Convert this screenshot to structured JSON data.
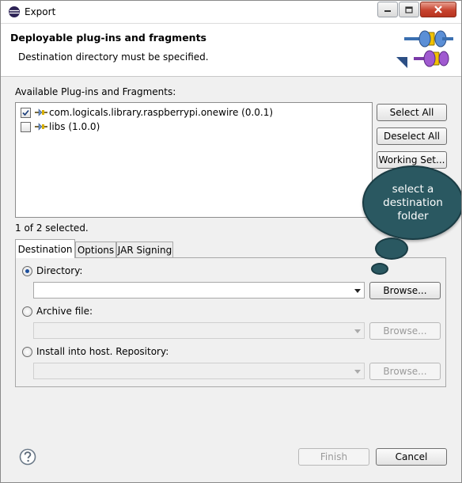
{
  "window": {
    "title": "Export",
    "minimize_label": "minimize",
    "maximize_label": "maximize",
    "close_label": "close"
  },
  "banner": {
    "title": "Deployable plug-ins and fragments",
    "message": "Destination directory must be specified."
  },
  "plugins": {
    "label": "Available Plug-ins and Fragments:",
    "items": [
      {
        "label": "com.logicals.library.raspberrypi.onewire (0.0.1)",
        "checked": true
      },
      {
        "label": "libs (1.0.0)",
        "checked": false
      }
    ],
    "select_all": "Select All",
    "deselect_all": "Deselect All",
    "working_set": "Working Set...",
    "status": "1 of 2 selected."
  },
  "tabs": [
    {
      "label": "Destination",
      "active": true
    },
    {
      "label": "Options",
      "active": false
    },
    {
      "label": "JAR Signing",
      "active": false
    }
  ],
  "destination": {
    "directory": {
      "label": "Directory:",
      "selected": true,
      "value": "",
      "browse": "Browse...",
      "enabled": true
    },
    "archive": {
      "label": "Archive file:",
      "selected": false,
      "value": "",
      "browse": "Browse...",
      "enabled": false
    },
    "install": {
      "label": "Install into host. Repository:",
      "selected": false,
      "value": "",
      "browse": "Browse...",
      "enabled": false
    }
  },
  "callout": {
    "line1": "select a",
    "line2": "destination",
    "line3": "folder",
    "color": "#2a5861"
  },
  "footer": {
    "help_icon": "question-mark-icon",
    "finish": "Finish",
    "cancel": "Cancel"
  }
}
